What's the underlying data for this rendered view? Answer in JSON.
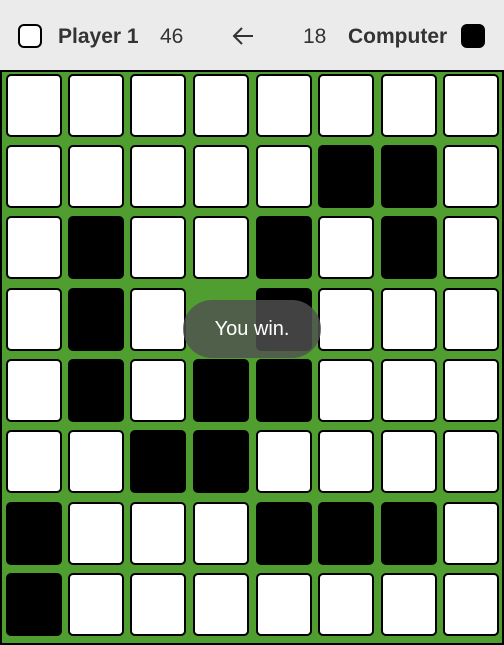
{
  "scoreboard": {
    "player1": {
      "name": "Player 1",
      "score": "46",
      "piece_color": "#ffffff",
      "icon": "white-piece-icon"
    },
    "player2": {
      "name": "Computer",
      "score": "18",
      "piece_color": "#000000",
      "icon": "black-piece-icon"
    },
    "turn_indicator": {
      "icon": "arrow-left-icon",
      "current_turn": "Player 1"
    }
  },
  "board": {
    "columns": 8,
    "rows": 8,
    "background_color": "#4f9e2f",
    "cells": [
      [
        "W",
        "W",
        "W",
        "W",
        "W",
        "W",
        "W",
        "W"
      ],
      [
        "W",
        "W",
        "W",
        "W",
        "W",
        "B",
        "B",
        "W"
      ],
      [
        "W",
        "B",
        "W",
        "W",
        "B",
        "W",
        "B",
        "W"
      ],
      [
        "W",
        "B",
        "W",
        "E",
        "B",
        "W",
        "W",
        "W"
      ],
      [
        "W",
        "B",
        "W",
        "B",
        "B",
        "W",
        "W",
        "W"
      ],
      [
        "W",
        "W",
        "B",
        "B",
        "W",
        "W",
        "W",
        "W"
      ],
      [
        "B",
        "W",
        "W",
        "W",
        "B",
        "B",
        "B",
        "W"
      ],
      [
        "B",
        "W",
        "W",
        "W",
        "W",
        "W",
        "W",
        "W"
      ]
    ]
  },
  "toast": {
    "message": "You win."
  }
}
